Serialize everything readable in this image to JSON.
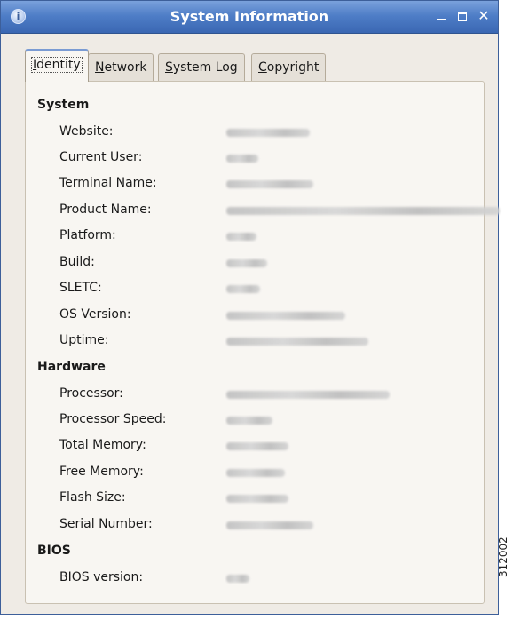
{
  "window": {
    "title": "System Information",
    "icon": "info-icon",
    "controls": {
      "minimize": "minimize",
      "maximize": "maximize",
      "close": "close"
    }
  },
  "tabs": [
    {
      "label_prefix": "",
      "mnemonic": "I",
      "label_rest": "dentity",
      "active": true
    },
    {
      "label_prefix": "",
      "mnemonic": "N",
      "label_rest": "etwork",
      "active": false
    },
    {
      "label_prefix": "",
      "mnemonic": "S",
      "label_rest": "ystem Log",
      "active": false
    },
    {
      "label_prefix": "",
      "mnemonic": "C",
      "label_rest": "opyright",
      "active": false
    }
  ],
  "sections": {
    "system": {
      "title": "System",
      "rows": [
        {
          "label": "Website:",
          "value": "[blurred]"
        },
        {
          "label": "Current User:",
          "value": "[blurred]"
        },
        {
          "label": "Terminal Name:",
          "value": "[blurred]"
        },
        {
          "label": "Product Name:",
          "value": "[blurred]"
        },
        {
          "label": "Platform:",
          "value": "[blurred]"
        },
        {
          "label": "Build:",
          "value": "[blurred]"
        },
        {
          "label": "SLETC:",
          "value": "[blurred]"
        },
        {
          "label": "OS Version:",
          "value": "[blurred]"
        },
        {
          "label": "Uptime:",
          "value": "[blurred]"
        }
      ]
    },
    "hardware": {
      "title": "Hardware",
      "rows": [
        {
          "label": "Processor:",
          "value": "[blurred]"
        },
        {
          "label": "Processor Speed:",
          "value": "[blurred]"
        },
        {
          "label": "Total Memory:",
          "value": "[blurred]"
        },
        {
          "label": "Free Memory:",
          "value": "[blurred]"
        },
        {
          "label": "Flash Size:",
          "value": "[blurred]"
        },
        {
          "label": "Serial Number:",
          "value": "[blurred]"
        }
      ]
    },
    "bios": {
      "title": "BIOS",
      "rows": [
        {
          "label": "BIOS version:",
          "value": "[blurred]"
        }
      ]
    }
  },
  "figure_number": "312002",
  "colors": {
    "titlebar": "#4f7ec7",
    "panel": "#f8f6f2",
    "window_bg": "#efebe5"
  }
}
